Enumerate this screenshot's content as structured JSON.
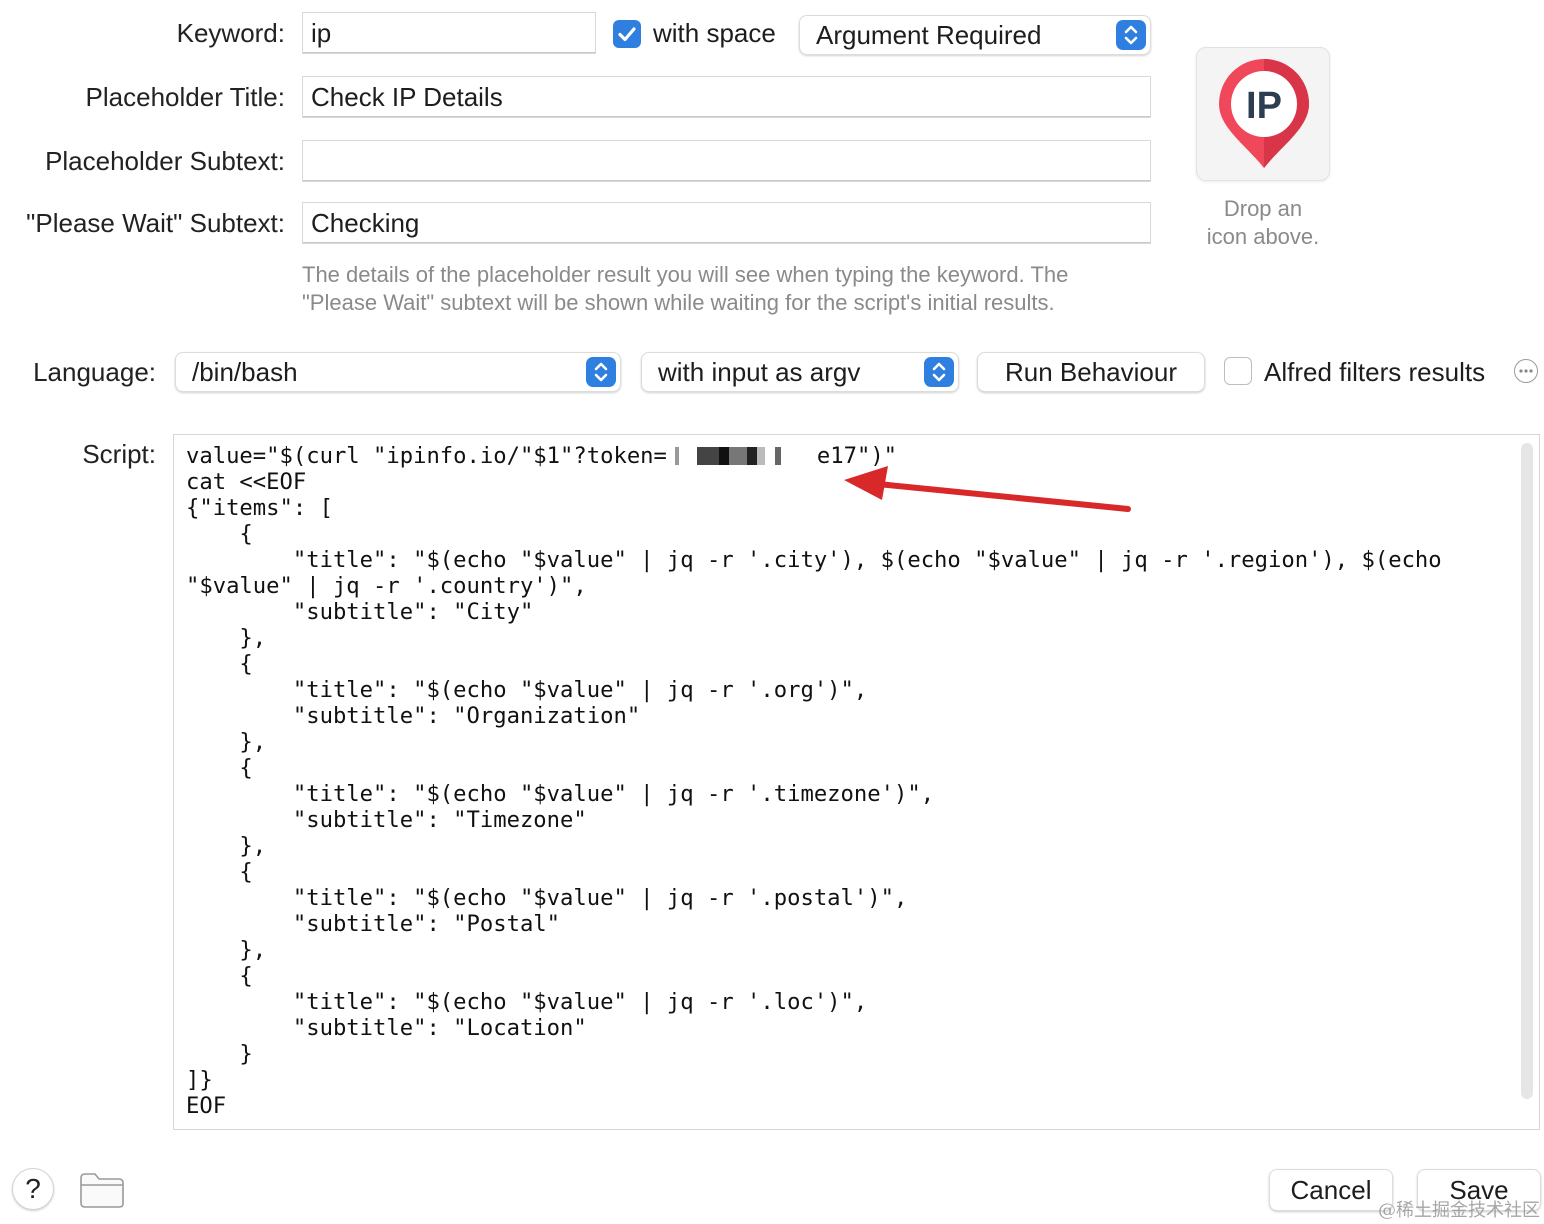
{
  "form": {
    "keyword_label": "Keyword:",
    "keyword_value": "ip",
    "with_space_label": "with space",
    "argument_mode": "Argument Required",
    "placeholder_title_label": "Placeholder Title:",
    "placeholder_title_value": "Check IP Details",
    "placeholder_subtext_label": "Placeholder Subtext:",
    "placeholder_subtext_value": "",
    "please_wait_label": "\"Please Wait\" Subtext:",
    "please_wait_value": "Checking",
    "help_line1": "The details of the placeholder result you will see when typing the keyword. The",
    "help_line2": "\"Please Wait\" subtext will be shown while waiting for the script's initial results."
  },
  "icon_well": {
    "icon_text": "IP",
    "hint_line1": "Drop an",
    "hint_line2": "icon above.",
    "colors": {
      "pin": "#f0475a",
      "pin_dark": "#d93549",
      "letters": "#2d3e50"
    }
  },
  "language": {
    "label": "Language:",
    "value": "/bin/bash",
    "input_mode": "with input as argv",
    "run_behaviour_label": "Run Behaviour",
    "alfred_filters_label": "Alfred filters results"
  },
  "script": {
    "label": "Script:",
    "line1_prefix": "value=\"$(curl \"ipinfo.io/\"$1\"?token=",
    "line1_suffix": "e17\")\"",
    "body": "\ncat <<EOF\n{\"items\": [\n    {\n        \"title\": \"$(echo \"$value\" | jq -r '.city'), $(echo \"$value\" | jq -r '.region'), $(echo\n\"$value\" | jq -r '.country')\",\n        \"subtitle\": \"City\"\n    },\n    {\n        \"title\": \"$(echo \"$value\" | jq -r '.org')\",\n        \"subtitle\": \"Organization\"\n    },\n    {\n        \"title\": \"$(echo \"$value\" | jq -r '.timezone')\",\n        \"subtitle\": \"Timezone\"\n    },\n    {\n        \"title\": \"$(echo \"$value\" | jq -r '.postal')\",\n        \"subtitle\": \"Postal\"\n    },\n    {\n        \"title\": \"$(echo \"$value\" | jq -r '.loc')\",\n        \"subtitle\": \"Location\"\n    }\n]}\nEOF"
  },
  "footer": {
    "help_symbol": "?",
    "cancel_label": "Cancel",
    "save_label": "Save",
    "watermark": "@稀土掘金技术社区"
  },
  "colors": {
    "accent": "#2f7fe0",
    "annotation_arrow": "#d8282a"
  }
}
